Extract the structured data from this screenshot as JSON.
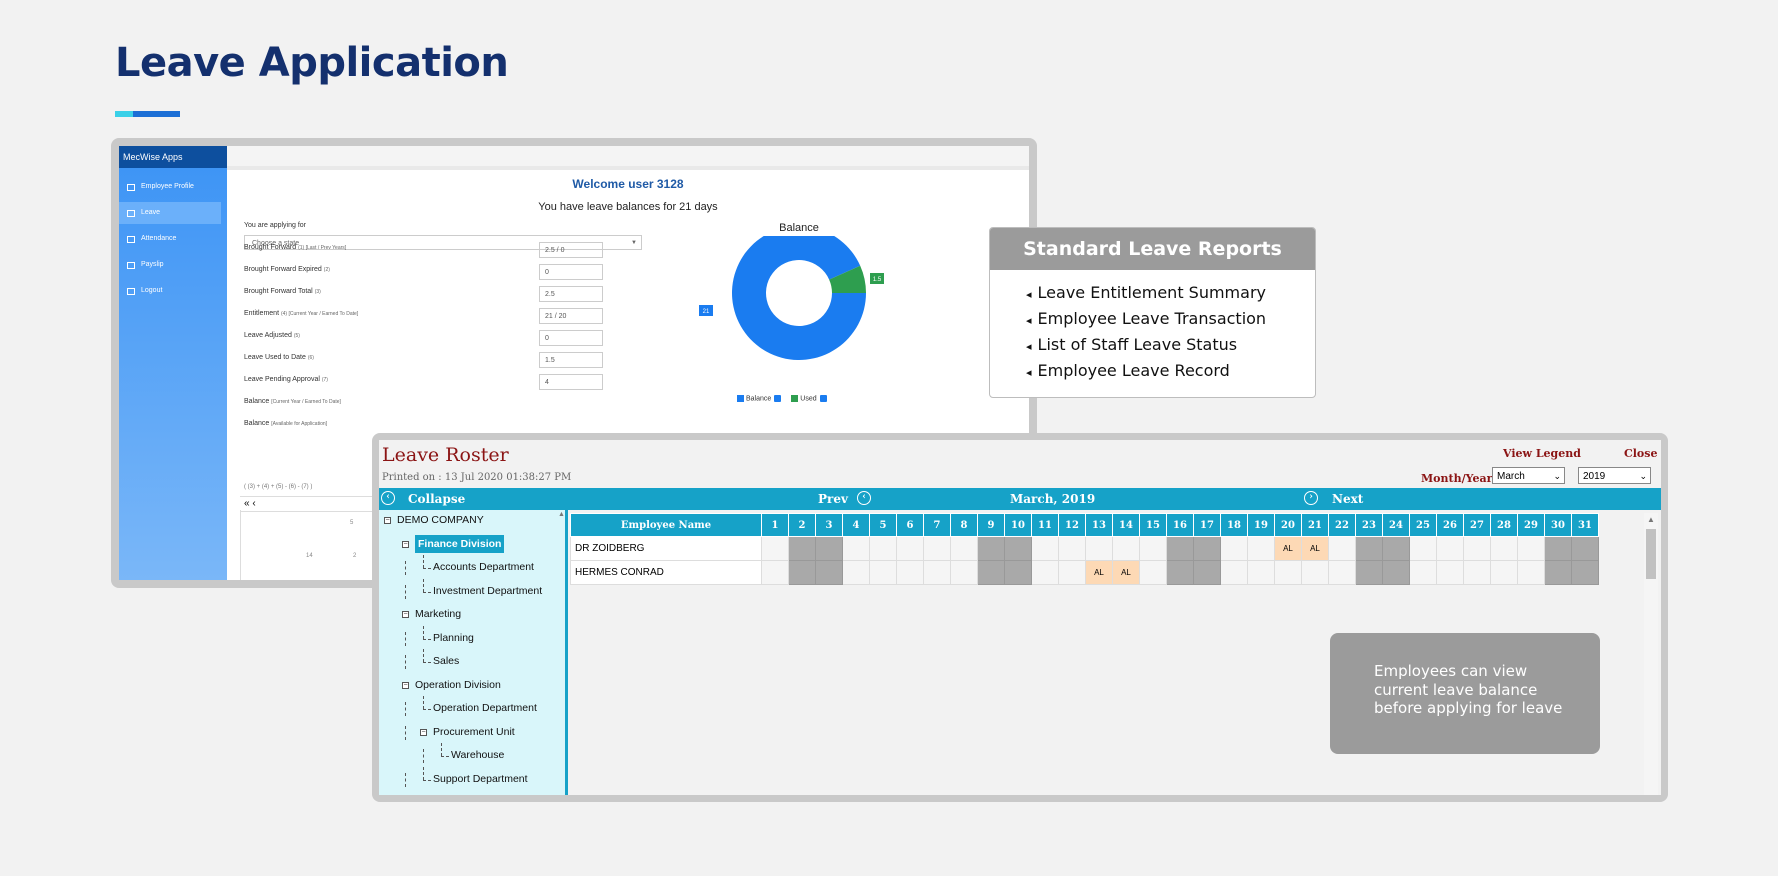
{
  "page": {
    "title": "Leave Application"
  },
  "app": {
    "brand": "MecWise Apps",
    "sidebar": [
      {
        "label": "Employee Profile",
        "active": false
      },
      {
        "label": "Leave",
        "active": true
      },
      {
        "label": "Attendance",
        "active": false
      },
      {
        "label": "Payslip",
        "active": false
      },
      {
        "label": "Logout",
        "active": false
      }
    ],
    "welcome": "Welcome user 3128",
    "balance_message": "You have leave balances for 21 days",
    "applying_for_label": "You are applying for",
    "state_placeholder": "Choose a state",
    "fields": [
      {
        "label": "Brought Forward",
        "note": "(1) [Last / Prev Years]",
        "value": "2.5 / 0"
      },
      {
        "label": "Brought Forward Expired",
        "note": "(2)",
        "value": "0"
      },
      {
        "label": "Brought Forward Total",
        "note": "(3)",
        "value": "2.5"
      },
      {
        "label": "Entitlement",
        "note": "(4) [Current Year / Earned To Date]",
        "value": "21 / 20"
      },
      {
        "label": "Leave Adjusted",
        "note": "(5)",
        "value": "0"
      },
      {
        "label": "Leave Used to Date",
        "note": "(6)",
        "value": "1.5"
      },
      {
        "label": "Leave Pending Approval",
        "note": "(7)",
        "value": "4"
      },
      {
        "label": "Balance",
        "note": "[Current Year / Earned To Date]",
        "value": ""
      },
      {
        "label": "Balance",
        "note": "[Available for Application]",
        "value": ""
      }
    ],
    "formula": "( (3) + (4) + (5) - (6) - (7) )",
    "pager": "« ‹",
    "pager_ticks": [
      "5",
      "14",
      "2"
    ]
  },
  "chart_data": {
    "type": "pie",
    "title": "Balance",
    "labels": [
      "Balance",
      "Used"
    ],
    "values": [
      21,
      1.5
    ],
    "colors": [
      "#1a7cf0",
      "#2e9e4f"
    ],
    "donut": true,
    "legend_placement": "bottom"
  },
  "reports": {
    "title": "Standard Leave Reports",
    "marker": "◂",
    "items": [
      "Leave Entitlement Summary",
      "Employee Leave Transaction",
      "List of Staff Leave Status",
      "Employee Leave Record"
    ]
  },
  "roster": {
    "title": "Leave Roster",
    "printed_on": "Printed on : 13 Jul 2020 01:38:27 PM",
    "view_legend": "View Legend",
    "close": "Close",
    "month_year_label": "Month/Year",
    "month": "March",
    "year": "2019",
    "collapse": "Collapse",
    "prev": "Prev",
    "period": "March, 2019",
    "next": "Next",
    "name_header": "Employee Name",
    "days": [
      "1",
      "2",
      "3",
      "4",
      "5",
      "6",
      "7",
      "8",
      "9",
      "10",
      "11",
      "12",
      "13",
      "14",
      "15",
      "16",
      "17",
      "18",
      "19",
      "20",
      "21",
      "22",
      "23",
      "24",
      "25",
      "26",
      "27",
      "28",
      "29",
      "30",
      "31"
    ],
    "weekend_days": [
      2,
      3,
      9,
      10,
      16,
      17,
      23,
      24,
      30,
      31
    ],
    "employees": [
      {
        "name": "DR ZOIDBERG",
        "leave_days": [
          20,
          21
        ],
        "code": "AL"
      },
      {
        "name": "HERMES CONRAD",
        "leave_days": [
          13,
          14
        ],
        "code": "AL"
      }
    ],
    "tree": [
      {
        "label": "DEMO COMPANY"
      },
      {
        "label": "Finance Division"
      },
      {
        "label": "Accounts Department"
      },
      {
        "label": "Investment Department"
      },
      {
        "label": "Marketing"
      },
      {
        "label": "Planning"
      },
      {
        "label": "Sales"
      },
      {
        "label": "Operation Division"
      },
      {
        "label": "Operation Department"
      },
      {
        "label": "Procurement Unit"
      },
      {
        "label": "Warehouse"
      },
      {
        "label": "Support Department"
      }
    ]
  },
  "note": {
    "text": "Employees can view current leave balance before applying for leave"
  }
}
